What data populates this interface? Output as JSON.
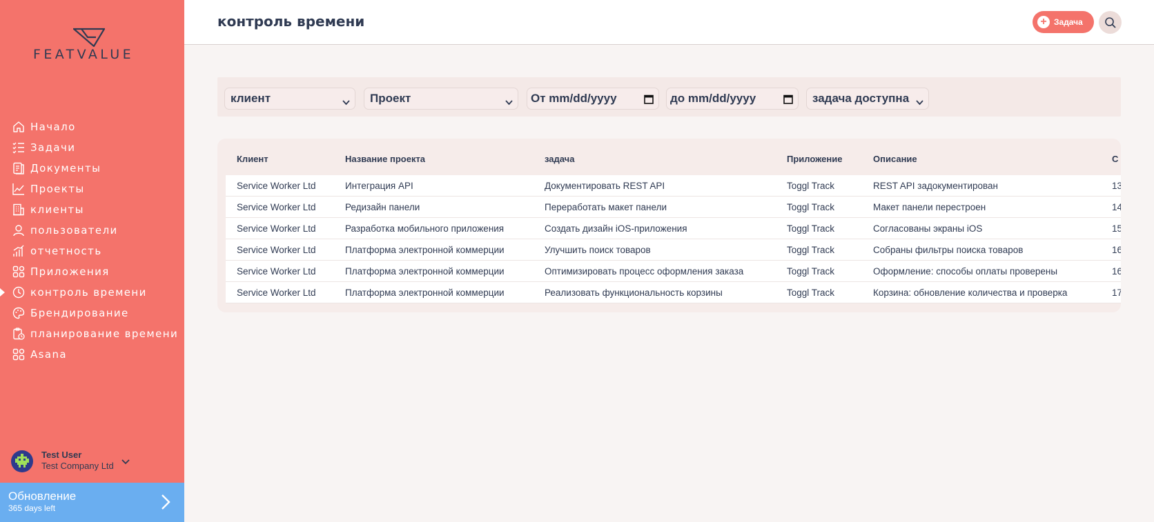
{
  "brand": {
    "logo_text": "FEATVALUE",
    "accent": "#f4736b",
    "dark": "#2f3a52"
  },
  "sidebar": {
    "items": [
      {
        "label": "Начало",
        "icon": "home-icon"
      },
      {
        "label": "Задачи",
        "icon": "tasks-list-icon"
      },
      {
        "label": "Документы",
        "icon": "documents-icon"
      },
      {
        "label": "Проекты",
        "icon": "projects-chart-icon"
      },
      {
        "label": "клиенты",
        "icon": "clients-building-icon"
      },
      {
        "label": "пользователи",
        "icon": "user-icon"
      },
      {
        "label": "отчетность",
        "icon": "reports-bars-icon"
      },
      {
        "label": "Приложения",
        "icon": "apps-grid-icon"
      },
      {
        "label": "контроль времени",
        "icon": "time-clock-icon",
        "active": true
      },
      {
        "label": "Брендирование",
        "icon": "palette-icon"
      },
      {
        "label": "планирование времени",
        "icon": "clipboard-clock-icon"
      },
      {
        "label": "Asana",
        "icon": "asana-grid-icon"
      }
    ],
    "user": {
      "name": "Test User",
      "company": "Test Company Ltd"
    },
    "upgrade": {
      "title": "Обновление",
      "subtitle": "365 days left"
    }
  },
  "header": {
    "title": "контроль времени",
    "task_button": "Задача"
  },
  "filters": {
    "client": "клиент",
    "project": "Проект",
    "from_date": "От mm/dd/yyyy",
    "to_date": "до mm/dd/yyyy",
    "task_status": "задача доступна"
  },
  "table": {
    "columns": [
      "Клиент",
      "Название проекта",
      "задача",
      "Приложение",
      "Описание",
      "С"
    ],
    "rows": [
      [
        "Service Worker Ltd",
        "Интеграция API",
        "Документировать REST API",
        "Toggl Track",
        "REST API задокументирован",
        "13"
      ],
      [
        "Service Worker Ltd",
        "Редизайн панели",
        "Переработать макет панели",
        "Toggl Track",
        "Макет панели перестроен",
        "14"
      ],
      [
        "Service Worker Ltd",
        "Разработка мобильного приложения",
        "Создать дизайн iOS-приложения",
        "Toggl Track",
        "Согласованы экраны iOS",
        "15"
      ],
      [
        "Service Worker Ltd",
        "Платформа электронной коммерции",
        "Улучшить поиск товаров",
        "Toggl Track",
        "Собраны фильтры поиска товаров",
        "16"
      ],
      [
        "Service Worker Ltd",
        "Платформа электронной коммерции",
        "Оптимизировать процесс оформления заказа",
        "Toggl Track",
        "Оформление: способы оплаты проверены",
        "16"
      ],
      [
        "Service Worker Ltd",
        "Платформа электронной коммерции",
        "Реализовать функциональность корзины",
        "Toggl Track",
        "Корзина: обновление количества и проверка",
        "17"
      ]
    ]
  }
}
